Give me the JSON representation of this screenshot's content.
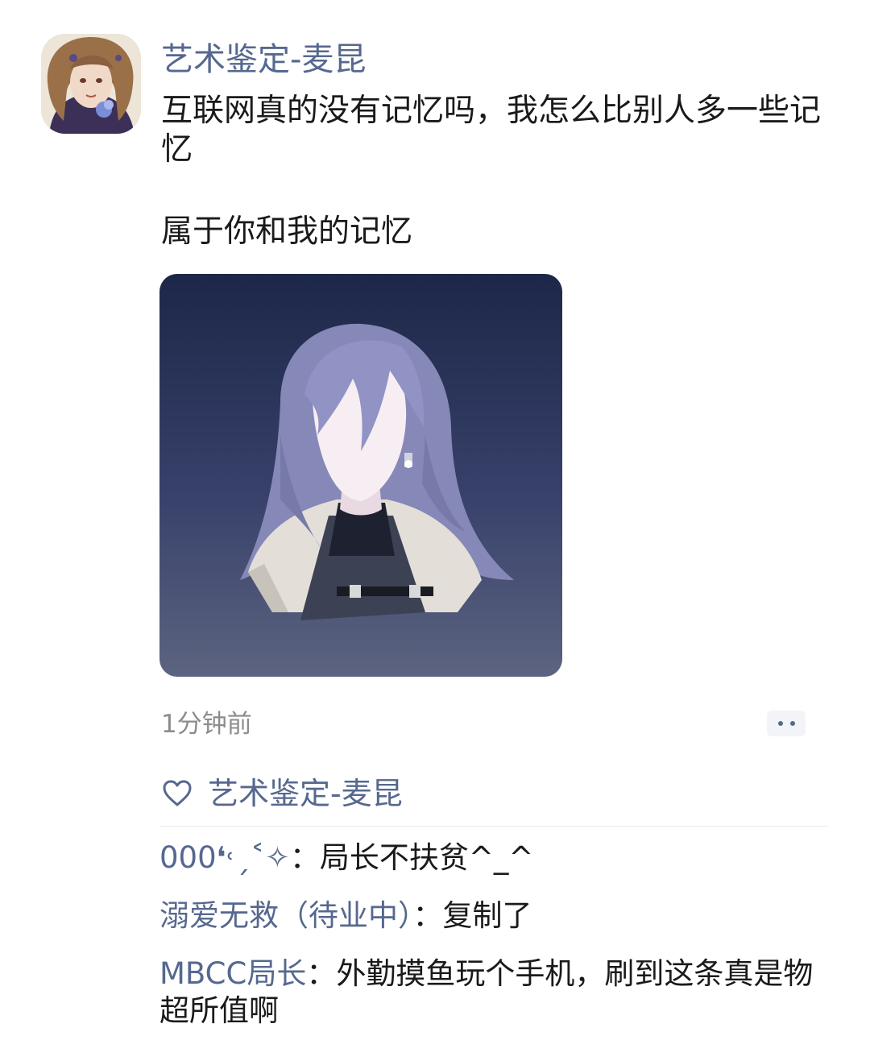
{
  "post": {
    "author": "艺术鉴定-麦昆",
    "text_line1": "互联网真的没有记忆吗，我怎么比别人多一些记忆",
    "text_line2": "属于你和我的记忆",
    "timestamp": "1分钟前"
  },
  "icons": {
    "more": "more-dots-icon",
    "like": "heart-outline-icon"
  },
  "likes": {
    "names": "艺术鉴定-麦昆"
  },
  "comments": [
    {
      "user": "000❛˓ˏ˂✧",
      "sep": "：",
      "text": "局长不扶贫^_^"
    },
    {
      "user": "溺爱无救（待业中）",
      "sep": "：",
      "text": "复制了"
    },
    {
      "user": "MBCC局长",
      "sep": "：",
      "text": "外勤摸鱼玩个手机，刷到这条真是物超所值啊"
    }
  ],
  "colors": {
    "link": "#56688f",
    "text": "#1a1a1a",
    "muted": "#8c8c8c",
    "image_bg_top": "#1c2748",
    "image_bg_bottom": "#5c6480"
  }
}
